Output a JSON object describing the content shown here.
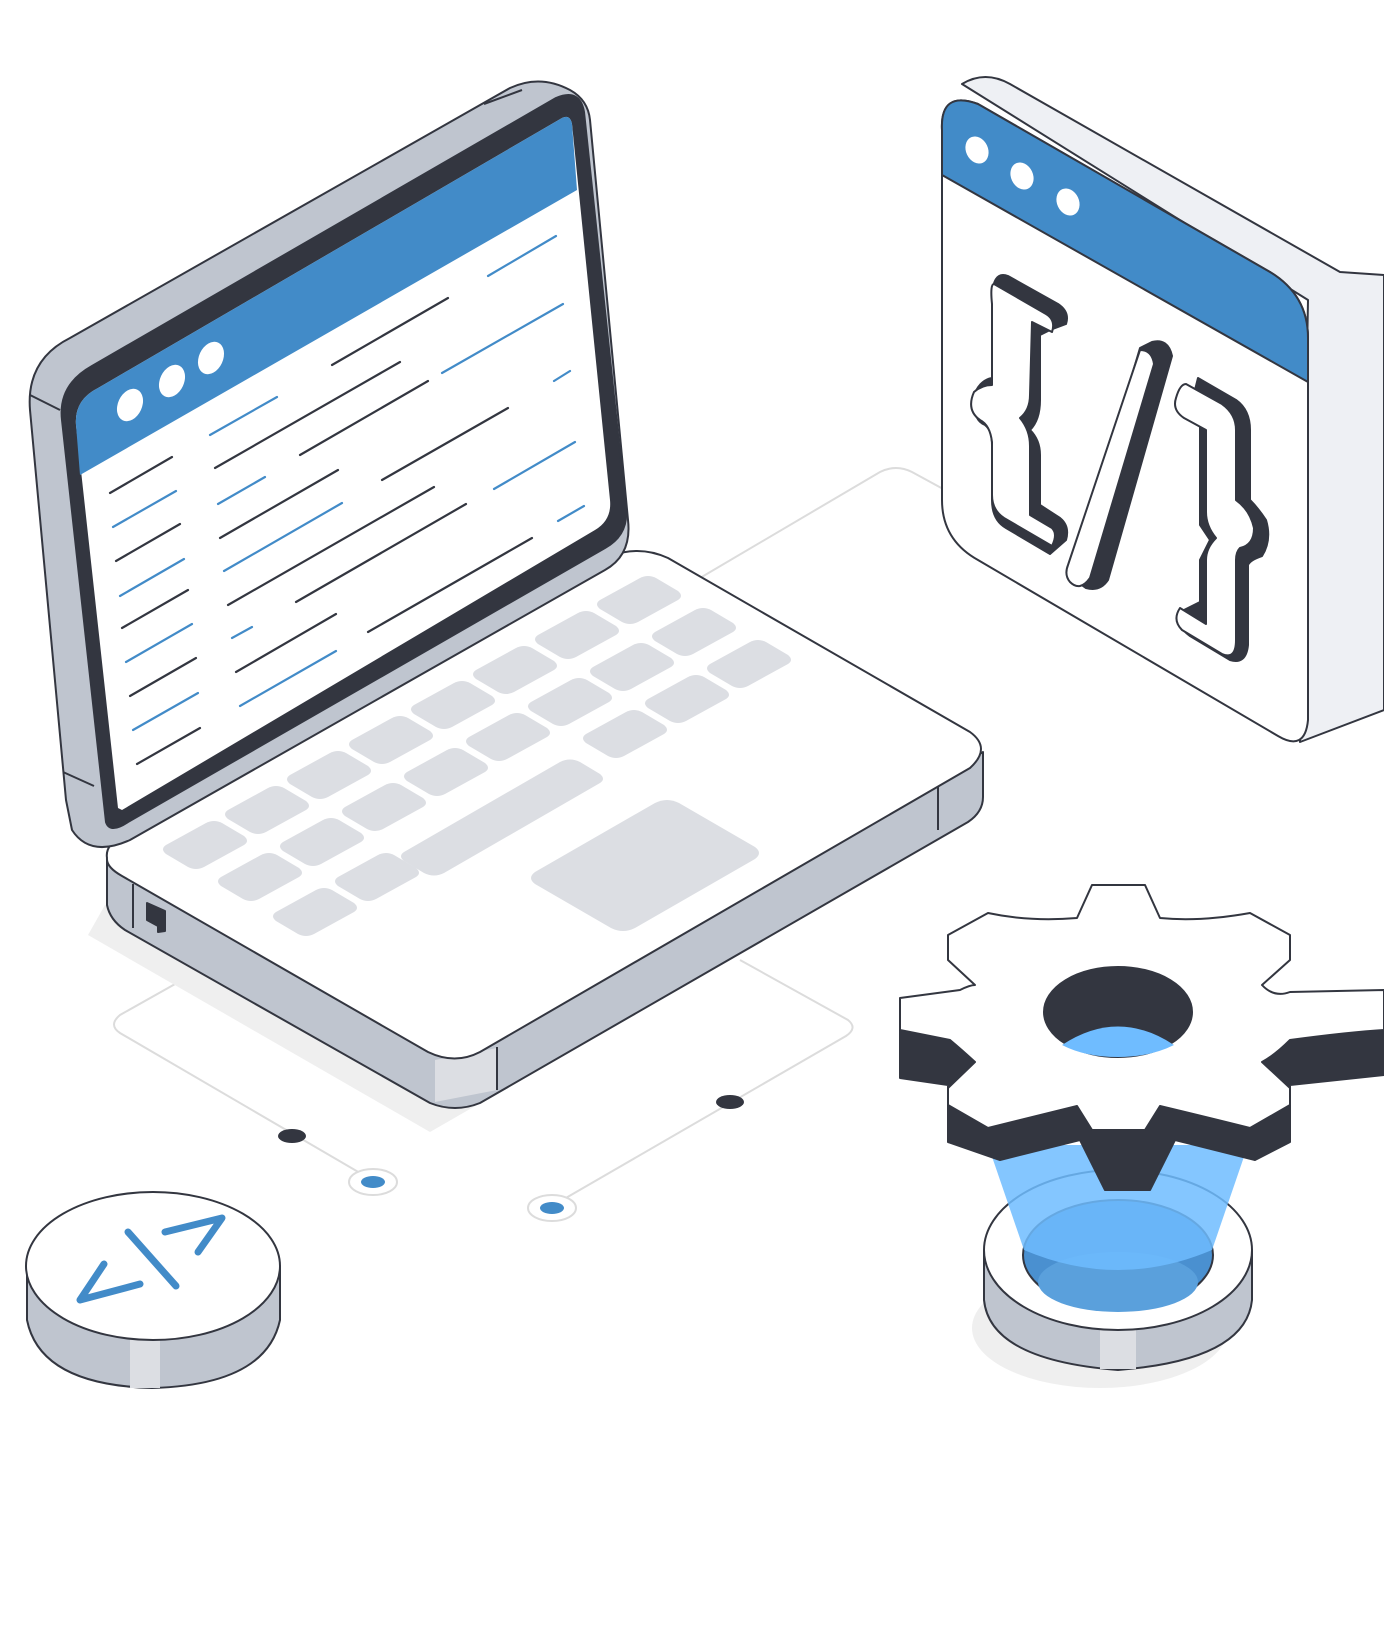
{
  "illustration": {
    "elements": [
      "laptop",
      "code-window",
      "gear",
      "code-token",
      "connector-lines"
    ]
  },
  "colors": {
    "outline": "#333640",
    "accent_blue": "#428bc8",
    "light_blue": "#6fbcff",
    "key_gray": "#dcdee3",
    "metal_gray": "#bfc5cf",
    "panel_light": "#eef0f4",
    "shadow": "#efefef",
    "white": "#ffffff"
  },
  "laptop": {
    "screen_dots": 3,
    "code_lines_count": 33
  },
  "code_window": {
    "dots": 3,
    "glyph": "{/}"
  },
  "token": {
    "glyph": "</>"
  },
  "icons": [
    "laptop-icon",
    "code-window-icon",
    "gear-icon",
    "code-token-icon"
  ]
}
